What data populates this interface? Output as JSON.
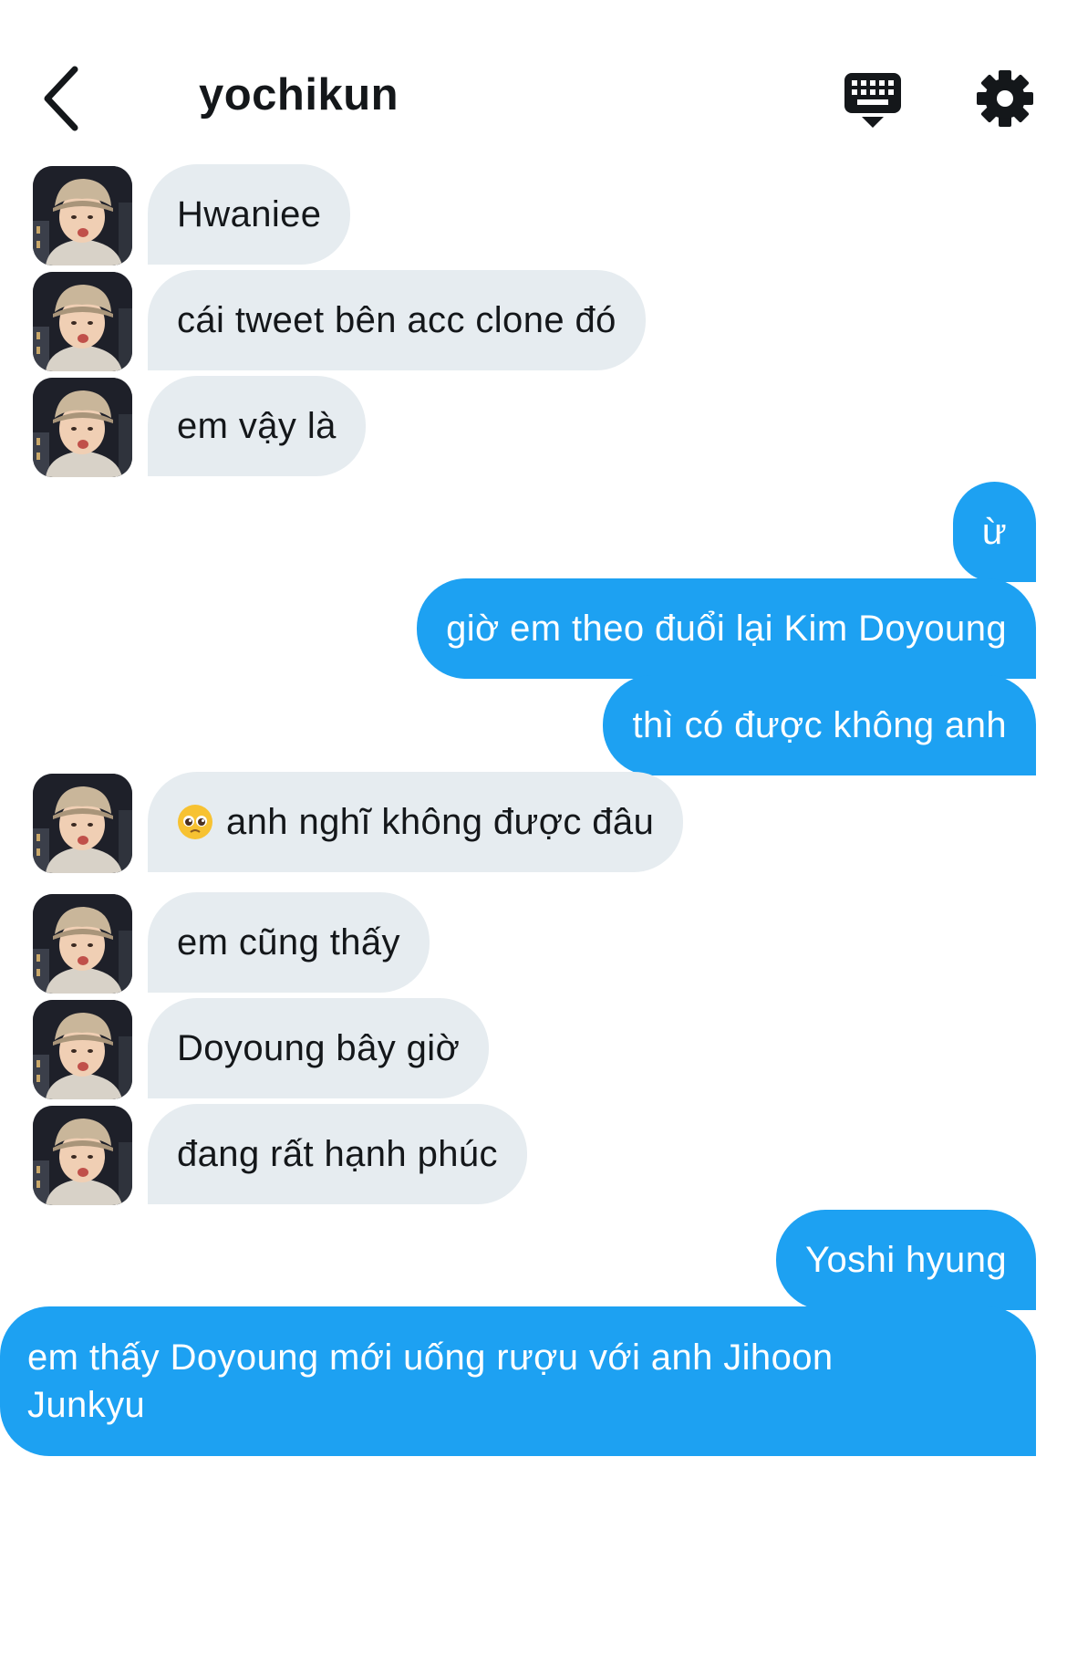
{
  "header": {
    "title": "yochikun",
    "back_icon": "chevron-left-icon",
    "keyboard_icon": "keyboard-icon",
    "settings_icon": "gear-icon"
  },
  "messages": [
    {
      "side": "in",
      "text": "Hwaniee"
    },
    {
      "side": "in",
      "text": "cái tweet bên acc clone đó"
    },
    {
      "side": "in",
      "text": "em vậy là"
    },
    {
      "side": "out",
      "text": "ừ"
    },
    {
      "side": "out",
      "text": "giờ em theo đuổi lại Kim Doyoung"
    },
    {
      "side": "out",
      "text": "thì có được không anh"
    },
    {
      "side": "in",
      "emoji": "pleading-face-emoji",
      "text": "anh nghĩ không được đâu"
    },
    {
      "side": "in",
      "text": "em cũng thấy"
    },
    {
      "side": "in",
      "text": "Doyoung bây giờ"
    },
    {
      "side": "in",
      "text": "đang rất hạnh phúc"
    },
    {
      "side": "out",
      "text": "Yoshi hyung"
    },
    {
      "side": "out",
      "text": "em thấy Doyoung mới uống rượu với anh Jihoon Junkyu"
    }
  ],
  "colors": {
    "outgoing_bubble": "#1da1f2",
    "incoming_bubble": "#e6ecf0",
    "text_dark": "#14171a",
    "background": "#ffffff"
  }
}
